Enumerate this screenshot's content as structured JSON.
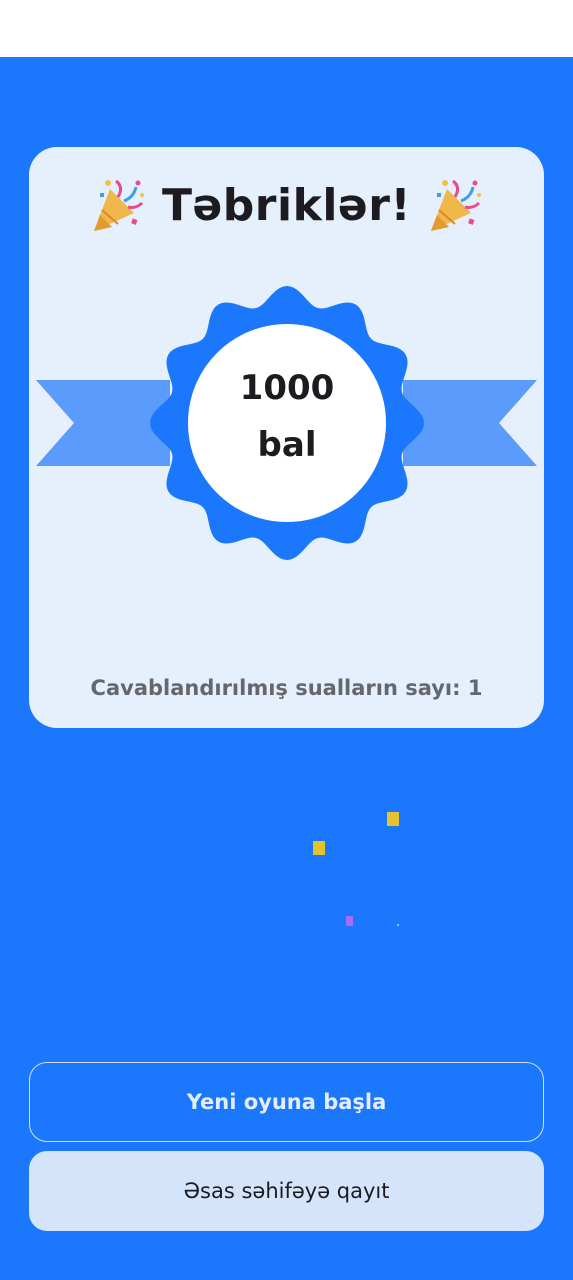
{
  "colors": {
    "background": "#1b78fd",
    "card": "#e6f0fd",
    "badge": "#1b78fd",
    "ribbon": "#5a9bfb",
    "accent_text": "#1d1b20",
    "confetti_yellow": "#e5c330",
    "confetti_purple": "#a66df5"
  },
  "header": {
    "title": "Təbriklər!",
    "left_icon": "party-popper-icon",
    "right_icon": "party-popper-icon"
  },
  "badge": {
    "score": "1000",
    "unit": "bal"
  },
  "stats": {
    "answered_text": "Cavablandırılmış sualların sayı: 1"
  },
  "buttons": {
    "new_game": "Yeni oyuna başla",
    "home": "Əsas səhifəyə qayıt"
  }
}
